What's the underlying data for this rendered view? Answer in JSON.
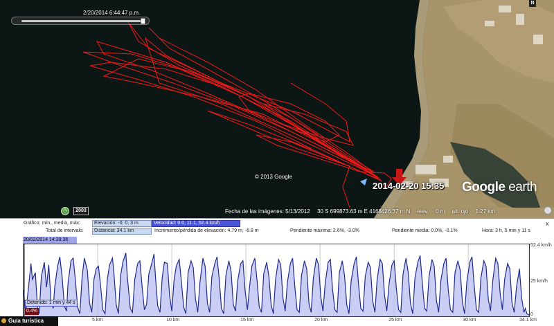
{
  "map": {
    "time_slider_label": "2/20/2014  6:44:47 p.m.",
    "compass_label": "N",
    "copyright": "© 2013 Google",
    "logo_google": "Google",
    "logo_earth": "earth",
    "marker_label": "2014-02-20 15:35",
    "year_badge": "2003",
    "status": {
      "imagery_date": "Fecha de las imágenes: 5/13/2012",
      "coords": "30 S 699873.63 m E 4168426.37 m N",
      "elev": "elev.",
      "elev_value": "0 m",
      "eye_alt": "alt. ojo",
      "eye_alt_value": "1.27 km"
    },
    "colors": {
      "track": "#ff1a1a",
      "sea": "#0d1a18",
      "land": "#a8946a",
      "marker": "#d61c1c"
    }
  },
  "profile": {
    "close_label": "x",
    "row1": {
      "graph_label": "Gráfico: mín., media, máx:",
      "elevation": "Elevación: -0, 0, 3 m",
      "speed": "Velocidad: 0.0, 11.1, 52.4 km/h"
    },
    "row2": {
      "total_label": "Total de intervalo:",
      "distance": "Distancia: 34.1 km",
      "elev_gain": "Incremento/pérdida de elevación: 4.79 m, -6.8 m",
      "max_slope": "Pendiente máxima: 2.6%, -3.0%",
      "avg_slope": "Pendiente media: 0.0%, -0.1%",
      "time": "Hora: 3 h, 5 min y 11 s"
    },
    "date_bar": "20/02/2014 14:39:36",
    "stop_label": "Detenido: 1 min y 44 s",
    "pct_label": "0.4%",
    "bottom_tab": "Guía turística"
  },
  "chart_data": {
    "type": "area",
    "title": "",
    "xlabel": "",
    "ylabel": "",
    "xlim": [
      0,
      34.1
    ],
    "ylim": [
      0,
      52.4
    ],
    "x_ticks": [
      "5 km",
      "10 km",
      "15 km",
      "20 km",
      "25 km",
      "30 km",
      "34.1 km"
    ],
    "x_tick_values": [
      5,
      10,
      15,
      20,
      25,
      30,
      34.1
    ],
    "y_ticks": [
      "52.4 km/h",
      "25 km/h",
      "0"
    ],
    "y_tick_values": [
      52.4,
      25,
      0
    ],
    "series": [
      {
        "values": [
          [
            0.0,
            20
          ],
          [
            0.1,
            8
          ],
          [
            0.15,
            3
          ],
          [
            0.3,
            18
          ],
          [
            0.5,
            40
          ],
          [
            0.6,
            28
          ],
          [
            0.8,
            33
          ],
          [
            0.95,
            5
          ],
          [
            1.05,
            2
          ],
          [
            1.2,
            30
          ],
          [
            1.4,
            41
          ],
          [
            1.55,
            22
          ],
          [
            1.7,
            39
          ],
          [
            1.85,
            12
          ],
          [
            2.0,
            6
          ],
          [
            2.1,
            22
          ],
          [
            2.3,
            38
          ],
          [
            2.45,
            45
          ],
          [
            2.6,
            30
          ],
          [
            2.75,
            8
          ],
          [
            2.9,
            4
          ],
          [
            3.0,
            25
          ],
          [
            3.2,
            42
          ],
          [
            3.35,
            44
          ],
          [
            3.5,
            27
          ],
          [
            3.65,
            7
          ],
          [
            3.8,
            2
          ],
          [
            3.95,
            30
          ],
          [
            4.1,
            44
          ],
          [
            4.3,
            35
          ],
          [
            4.45,
            10
          ],
          [
            4.6,
            3
          ],
          [
            4.75,
            28
          ],
          [
            4.9,
            36
          ],
          [
            5.05,
            38
          ],
          [
            5.2,
            23
          ],
          [
            5.35,
            5
          ],
          [
            5.5,
            2
          ],
          [
            5.65,
            28
          ],
          [
            5.8,
            39
          ],
          [
            6.0,
            44
          ],
          [
            6.1,
            32
          ],
          [
            6.25,
            9
          ],
          [
            6.4,
            2
          ],
          [
            6.55,
            31
          ],
          [
            6.7,
            41
          ],
          [
            6.9,
            48
          ],
          [
            7.0,
            30
          ],
          [
            7.2,
            6
          ],
          [
            7.35,
            3
          ],
          [
            7.5,
            28
          ],
          [
            7.7,
            40
          ],
          [
            7.85,
            42
          ],
          [
            8.0,
            22
          ],
          [
            8.15,
            5
          ],
          [
            8.3,
            9
          ],
          [
            8.45,
            32
          ],
          [
            8.6,
            38
          ],
          [
            8.8,
            47
          ],
          [
            8.9,
            30
          ],
          [
            9.05,
            8
          ],
          [
            9.2,
            3
          ],
          [
            9.35,
            29
          ],
          [
            9.5,
            41
          ],
          [
            9.7,
            40
          ],
          [
            9.85,
            16
          ],
          [
            10.0,
            4
          ],
          [
            10.15,
            27
          ],
          [
            10.3,
            38
          ],
          [
            10.5,
            43
          ],
          [
            10.65,
            26
          ],
          [
            10.8,
            7
          ],
          [
            10.95,
            2
          ],
          [
            11.1,
            33
          ],
          [
            11.3,
            42
          ],
          [
            11.45,
            37
          ],
          [
            11.6,
            13
          ],
          [
            11.75,
            3
          ],
          [
            11.9,
            26
          ],
          [
            12.1,
            44
          ],
          [
            12.25,
            38
          ],
          [
            12.4,
            10
          ],
          [
            12.55,
            3
          ],
          [
            12.7,
            30
          ],
          [
            12.9,
            40
          ],
          [
            13.05,
            45
          ],
          [
            13.2,
            28
          ],
          [
            13.35,
            6
          ],
          [
            13.5,
            2
          ],
          [
            13.65,
            31
          ],
          [
            13.85,
            42
          ],
          [
            14.0,
            34
          ],
          [
            14.15,
            9
          ],
          [
            14.3,
            4
          ],
          [
            14.45,
            27
          ],
          [
            14.65,
            40
          ],
          [
            14.8,
            42
          ],
          [
            14.95,
            19
          ],
          [
            15.1,
            5
          ],
          [
            15.25,
            23
          ],
          [
            15.4,
            38
          ],
          [
            15.6,
            44
          ],
          [
            15.75,
            27
          ],
          [
            15.9,
            7
          ],
          [
            16.05,
            3
          ],
          [
            16.2,
            32
          ],
          [
            16.4,
            41
          ],
          [
            16.55,
            30
          ],
          [
            16.7,
            9
          ],
          [
            16.85,
            2
          ],
          [
            17.0,
            28
          ],
          [
            17.2,
            43
          ],
          [
            17.35,
            39
          ],
          [
            17.5,
            14
          ],
          [
            17.65,
            4
          ],
          [
            17.8,
            26
          ],
          [
            18.0,
            40
          ],
          [
            18.15,
            44
          ],
          [
            18.3,
            22
          ],
          [
            18.45,
            5
          ],
          [
            18.6,
            3
          ],
          [
            18.75,
            31
          ],
          [
            18.95,
            42
          ],
          [
            19.1,
            36
          ],
          [
            19.25,
            10
          ],
          [
            19.4,
            3
          ],
          [
            19.55,
            29
          ],
          [
            19.75,
            44
          ],
          [
            19.9,
            39
          ],
          [
            20.05,
            15
          ],
          [
            20.2,
            4
          ],
          [
            20.35,
            25
          ],
          [
            20.55,
            41
          ],
          [
            20.7,
            43
          ],
          [
            20.85,
            20
          ],
          [
            21.0,
            5
          ],
          [
            21.15,
            3
          ],
          [
            21.3,
            33
          ],
          [
            21.5,
            42
          ],
          [
            21.65,
            31
          ],
          [
            21.8,
            9
          ],
          [
            21.95,
            2
          ],
          [
            22.1,
            27
          ],
          [
            22.3,
            40
          ],
          [
            22.45,
            45
          ],
          [
            22.6,
            24
          ],
          [
            22.75,
            6
          ],
          [
            22.9,
            4
          ],
          [
            23.05,
            30
          ],
          [
            23.25,
            41
          ],
          [
            23.4,
            37
          ],
          [
            23.55,
            12
          ],
          [
            23.7,
            3
          ],
          [
            23.85,
            28
          ],
          [
            24.05,
            43
          ],
          [
            24.2,
            40
          ],
          [
            24.35,
            16
          ],
          [
            24.5,
            4
          ],
          [
            24.65,
            24
          ],
          [
            24.85,
            39
          ],
          [
            25.0,
            42
          ],
          [
            25.15,
            21
          ],
          [
            25.3,
            5
          ],
          [
            25.45,
            3
          ],
          [
            25.6,
            32
          ],
          [
            25.8,
            44
          ],
          [
            25.95,
            33
          ],
          [
            26.1,
            10
          ],
          [
            26.25,
            2
          ],
          [
            26.4,
            29
          ],
          [
            26.6,
            41
          ],
          [
            26.75,
            46
          ],
          [
            26.9,
            25
          ],
          [
            27.05,
            6
          ],
          [
            27.2,
            4
          ],
          [
            27.35,
            30
          ],
          [
            27.55,
            43
          ],
          [
            27.7,
            38
          ],
          [
            27.85,
            12
          ],
          [
            28.0,
            3
          ],
          [
            28.15,
            27
          ],
          [
            28.35,
            40
          ],
          [
            28.5,
            44
          ],
          [
            28.65,
            20
          ],
          [
            28.8,
            5
          ],
          [
            28.95,
            3
          ],
          [
            29.1,
            33
          ],
          [
            29.3,
            42
          ],
          [
            29.45,
            35
          ],
          [
            29.6,
            11
          ],
          [
            29.75,
            2
          ],
          [
            29.9,
            26
          ],
          [
            30.1,
            41
          ],
          [
            30.25,
            45
          ],
          [
            30.4,
            23
          ],
          [
            30.55,
            5
          ],
          [
            30.7,
            3
          ],
          [
            30.85,
            29
          ],
          [
            31.05,
            42
          ],
          [
            31.2,
            38
          ],
          [
            31.35,
            13
          ],
          [
            31.5,
            4
          ],
          [
            31.65,
            27
          ],
          [
            31.85,
            44
          ],
          [
            32.0,
            40
          ],
          [
            32.15,
            17
          ],
          [
            32.3,
            5
          ],
          [
            32.45,
            28
          ],
          [
            32.65,
            40
          ],
          [
            32.8,
            36
          ],
          [
            32.95,
            10
          ],
          [
            33.1,
            3
          ],
          [
            33.25,
            22
          ],
          [
            33.45,
            36
          ],
          [
            33.6,
            14
          ],
          [
            33.75,
            3
          ],
          [
            33.85,
            6
          ],
          [
            33.95,
            2
          ],
          [
            34.1,
            1
          ]
        ]
      }
    ]
  }
}
